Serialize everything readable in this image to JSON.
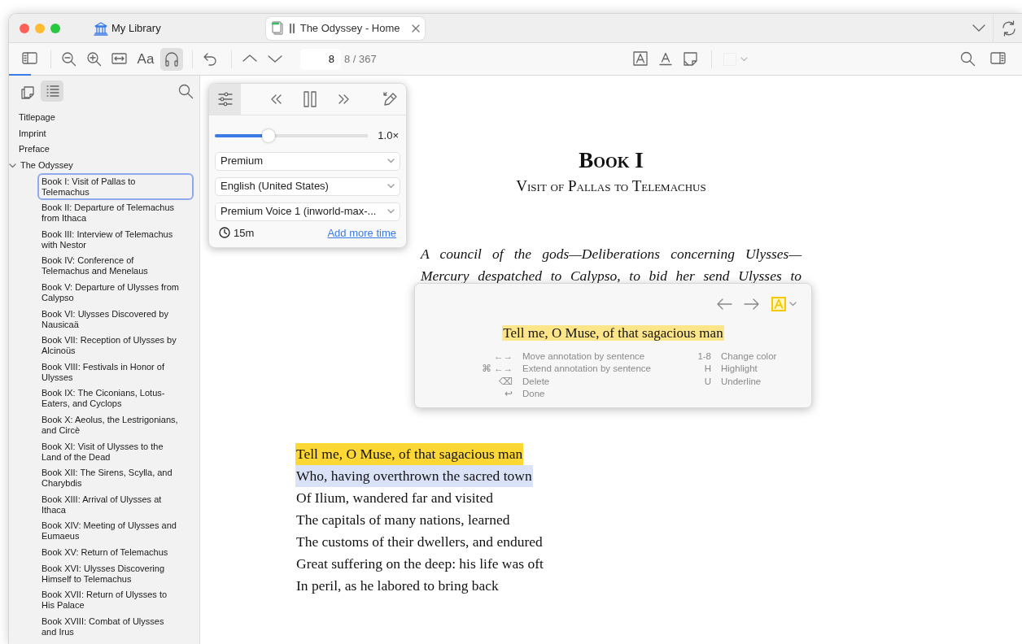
{
  "tabbar": {
    "library_label": "My Library",
    "tabs": [
      {
        "title": "The Odyssey - Home",
        "selected": true,
        "playing": true
      }
    ]
  },
  "toolbar": {
    "font_button": "Aa",
    "audio_active": true,
    "page_field": "8",
    "page_count": "8 / 367"
  },
  "reading_progress": {
    "level": 0.022
  },
  "sidebar": {
    "view_tabs": [
      {
        "selected": false
      },
      {
        "selected": true
      }
    ],
    "toc": [
      {
        "label": "Titlepage",
        "selected": false
      },
      {
        "label": "Imprint",
        "selected": false
      },
      {
        "label": "Preface",
        "selected": false
      },
      {
        "label": "The Odyssey",
        "selected": false,
        "expanded": true,
        "children": [
          {
            "label": "Book I: Visit of Pallas to Telemachus",
            "selected": true
          },
          {
            "label": "Book II: Departure of Telemachus from Ithaca",
            "selected": false
          },
          {
            "label": "Book III: Interview of Telemachus with Nestor",
            "selected": false
          },
          {
            "label": "Book IV: Conference of Telemachus and Menelaus",
            "selected": false
          },
          {
            "label": "Book V: Departure of Ulysses from Calypso",
            "selected": false
          },
          {
            "label": "Book VI: Ulysses Discovered by Nausicaä",
            "selected": false
          },
          {
            "label": "Book VII: Reception of Ulysses by Alcinoüs",
            "selected": false
          },
          {
            "label": "Book VIII: Festivals in Honor of Ulysses",
            "selected": false
          },
          {
            "label": "Book IX: The Ciconians, Lotus-Eaters, and Cyclops",
            "selected": false
          },
          {
            "label": "Book X: Aeolus, the Lestrigonians, and Circè",
            "selected": false
          },
          {
            "label": "Book XI: Visit of Ulysses to the Land of the Dead",
            "selected": false
          },
          {
            "label": "Book XII: The Sirens, Scylla, and Charybdis",
            "selected": false
          },
          {
            "label": "Book XIII: Arrival of Ulysses at Ithaca",
            "selected": false
          },
          {
            "label": "Book XIV: Meeting of Ulysses and Eumaeus",
            "selected": false
          },
          {
            "label": "Book XV: Return of Telemachus",
            "selected": false
          },
          {
            "label": "Book XVI: Ulysses Discovering Himself to Telemachus",
            "selected": false
          },
          {
            "label": "Book XVII: Return of Ulysses to His Palace",
            "selected": false
          },
          {
            "label": "Book XVIII: Combat of Ulysses and Irus",
            "selected": false
          }
        ]
      }
    ]
  },
  "audio_popup": {
    "settings_active": true,
    "playing": true,
    "speed_slider": {
      "level": 0.35
    },
    "speed": "1.0×",
    "selects": [
      {
        "value": "Premium"
      },
      {
        "value": "English (United States)"
      },
      {
        "value": "Premium Voice 1 (inworld-max-..."
      }
    ],
    "time_left": "15m",
    "add_time_link": "Add more time"
  },
  "book": {
    "chapter_title": "Book I",
    "chapter_subtitle": "Visit of Pallas to Telemachus",
    "summary": "A council of the gods—Deliberations concerning Ulysses—Mercury despatched to Calypso, to bid her send Ulysses to",
    "lines": [
      {
        "text": "Tell me, O Muse, of that sagacious man",
        "color": "#fdd835"
      },
      {
        "text": "Who, having overthrown the sacred town",
        "color": "#d9e2f6"
      },
      {
        "text": "Of Ilium, wandered far and visited"
      },
      {
        "text": "The capitals of many nations, learned"
      },
      {
        "text": "The customs of their dwellers, and endured"
      },
      {
        "text": "Great suffering on the deep: his life was oft"
      },
      {
        "text": "In peril, as he labored to bring back"
      }
    ]
  },
  "annotation_popup": {
    "color": "#f5c800",
    "quote": "Tell me, O Muse, of that sagacious man",
    "shortcuts_left": [
      {
        "keys": "←→",
        "action": "Move annotation by sentence"
      },
      {
        "keys": "⌘ ←→",
        "action": "Extend annotation by sentence"
      },
      {
        "keys": "⌫",
        "action": "Delete"
      },
      {
        "keys": "↩",
        "action": "Done"
      }
    ],
    "shortcuts_right": [
      {
        "keys": "1-8",
        "action": "Change color"
      },
      {
        "keys": "H",
        "action": "Highlight"
      },
      {
        "keys": "U",
        "action": "Underline"
      }
    ]
  }
}
